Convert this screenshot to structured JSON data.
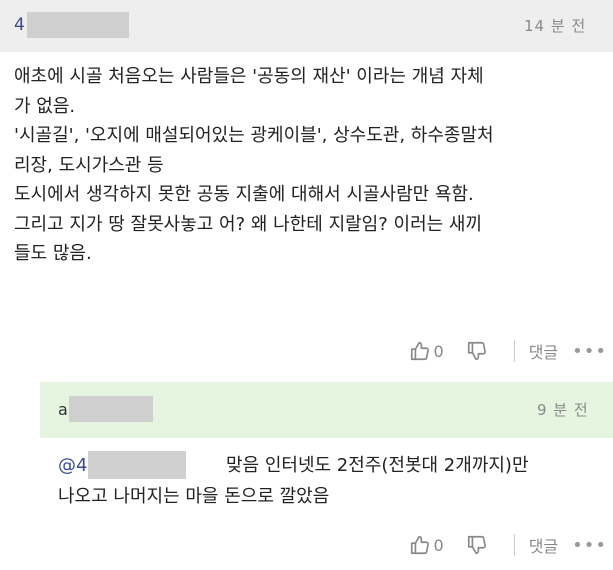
{
  "comment": {
    "author_initial": "4",
    "time": "14 분 전",
    "body": "애초에 시골 처음오는 사람들은 '공동의 재산' 이라는 개념 자체\n가 없음.\n'시골길', '오지에 매설되어있는 광케이블', 상수도관, 하수종말처\n리장, 도시가스관 등\n도시에서 생각하지 못한 공동 지출에 대해서 시골사람만 욕함.\n그리고 지가 땅 잘못사놓고 어? 왜 나한테 지랄임? 이러는 새끼\n들도 많음.",
    "like_count": "0",
    "reply_label": "댓글",
    "more_label": "•••"
  },
  "reply": {
    "author_initial": "a",
    "time": "9 분 전",
    "mention": "@4",
    "text_line1": "맞음 인터넷도 2전주(전봇대 2개까지)만",
    "text_line2": "나오고 나머지는 마을 돈으로 깔았음",
    "like_count": "0",
    "reply_label": "댓글",
    "more_label": "•••"
  },
  "colors": {
    "header_bg": "#eeeeee",
    "reply_header_bg": "#e6f5df",
    "redaction": "#cfcfcf",
    "mention": "#3a4a8a"
  }
}
